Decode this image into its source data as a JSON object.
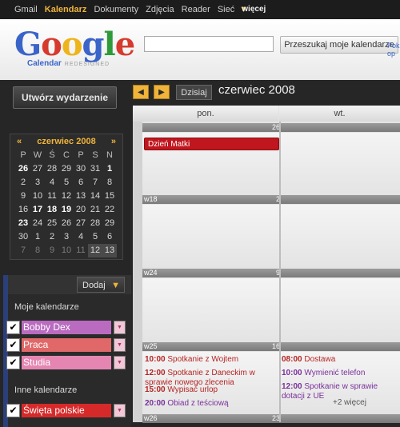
{
  "topnav": {
    "items": [
      "Gmail",
      "Kalendarz",
      "Dokumenty",
      "Zdjęcia",
      "Reader",
      "Sieć",
      "więcej"
    ],
    "more_caret": "▼"
  },
  "logo": {
    "word": [
      "G",
      "o",
      "o",
      "g",
      "l",
      "e"
    ],
    "sub": "Calendar",
    "sub2": "REDESIGNED"
  },
  "search": {
    "button_label": "Przeszukaj moje kalendarze",
    "options": "Pok op"
  },
  "sidebar": {
    "create_label": "Utwórz wydarzenie",
    "add_label": "Dodaj",
    "caret": "▼"
  },
  "minical": {
    "prev": "«",
    "next": "»",
    "title": "czerwiec 2008",
    "weekdays": [
      "P",
      "W",
      "Ś",
      "C",
      "P",
      "S",
      "N"
    ],
    "weeks": [
      [
        "26",
        "27",
        "28",
        "29",
        "30",
        "31",
        "1"
      ],
      [
        "2",
        "3",
        "4",
        "5",
        "6",
        "7",
        "8"
      ],
      [
        "9",
        "10",
        "11",
        "12",
        "13",
        "14",
        "15"
      ],
      [
        "16",
        "17",
        "18",
        "19",
        "20",
        "21",
        "22"
      ],
      [
        "23",
        "24",
        "25",
        "26",
        "27",
        "28",
        "29"
      ],
      [
        "30",
        "1",
        "2",
        "3",
        "4",
        "5",
        "6"
      ],
      [
        "7",
        "8",
        "9",
        "10",
        "11",
        "12",
        "13"
      ]
    ]
  },
  "calendars": {
    "mine_title": "Moje kalendarze",
    "mine": [
      {
        "name": "Bobby Dex",
        "color": "#b96bc0"
      },
      {
        "name": "Praca",
        "color": "#e06868"
      },
      {
        "name": "Studia",
        "color": "#e586b2"
      }
    ],
    "other_title": "Inne kalendarze",
    "other": [
      {
        "name": "Święta polskie",
        "color": "#d62a2a"
      }
    ],
    "check": "✔",
    "menu": "▼"
  },
  "toolbar": {
    "prev": "◀",
    "next": "▶",
    "today": "Dzisiaj",
    "period": "czerwiec 2008"
  },
  "grid": {
    "days": [
      "pon.",
      "wt."
    ],
    "weeks": [
      {
        "label": "",
        "date": "26"
      },
      {
        "label": "w18",
        "date": "2"
      },
      {
        "label": "w24",
        "date": "9"
      },
      {
        "label": "w25",
        "date": "16"
      },
      {
        "label": "w26",
        "date": "23"
      }
    ],
    "allday_event": "Dzień Matki",
    "events_mon": [
      {
        "time": "10:00",
        "title": "Spotkanie z Wojtem"
      },
      {
        "time": "12:00",
        "title": "Spotkanie z Daneckim w sprawie nowego zlecenia"
      },
      {
        "time": "15:00",
        "title": "Wypisać urlop"
      },
      {
        "time": "20:00",
        "title": "Obiad z teściową"
      }
    ],
    "events_tue": [
      {
        "time": "08:00",
        "title": "Dostawa"
      },
      {
        "time": "10:00",
        "title": "Wymienić telefon"
      },
      {
        "time": "12:00",
        "title": "Spotkanie w sprawie dotacji z UE"
      }
    ],
    "more_label": "+2 więcej"
  }
}
